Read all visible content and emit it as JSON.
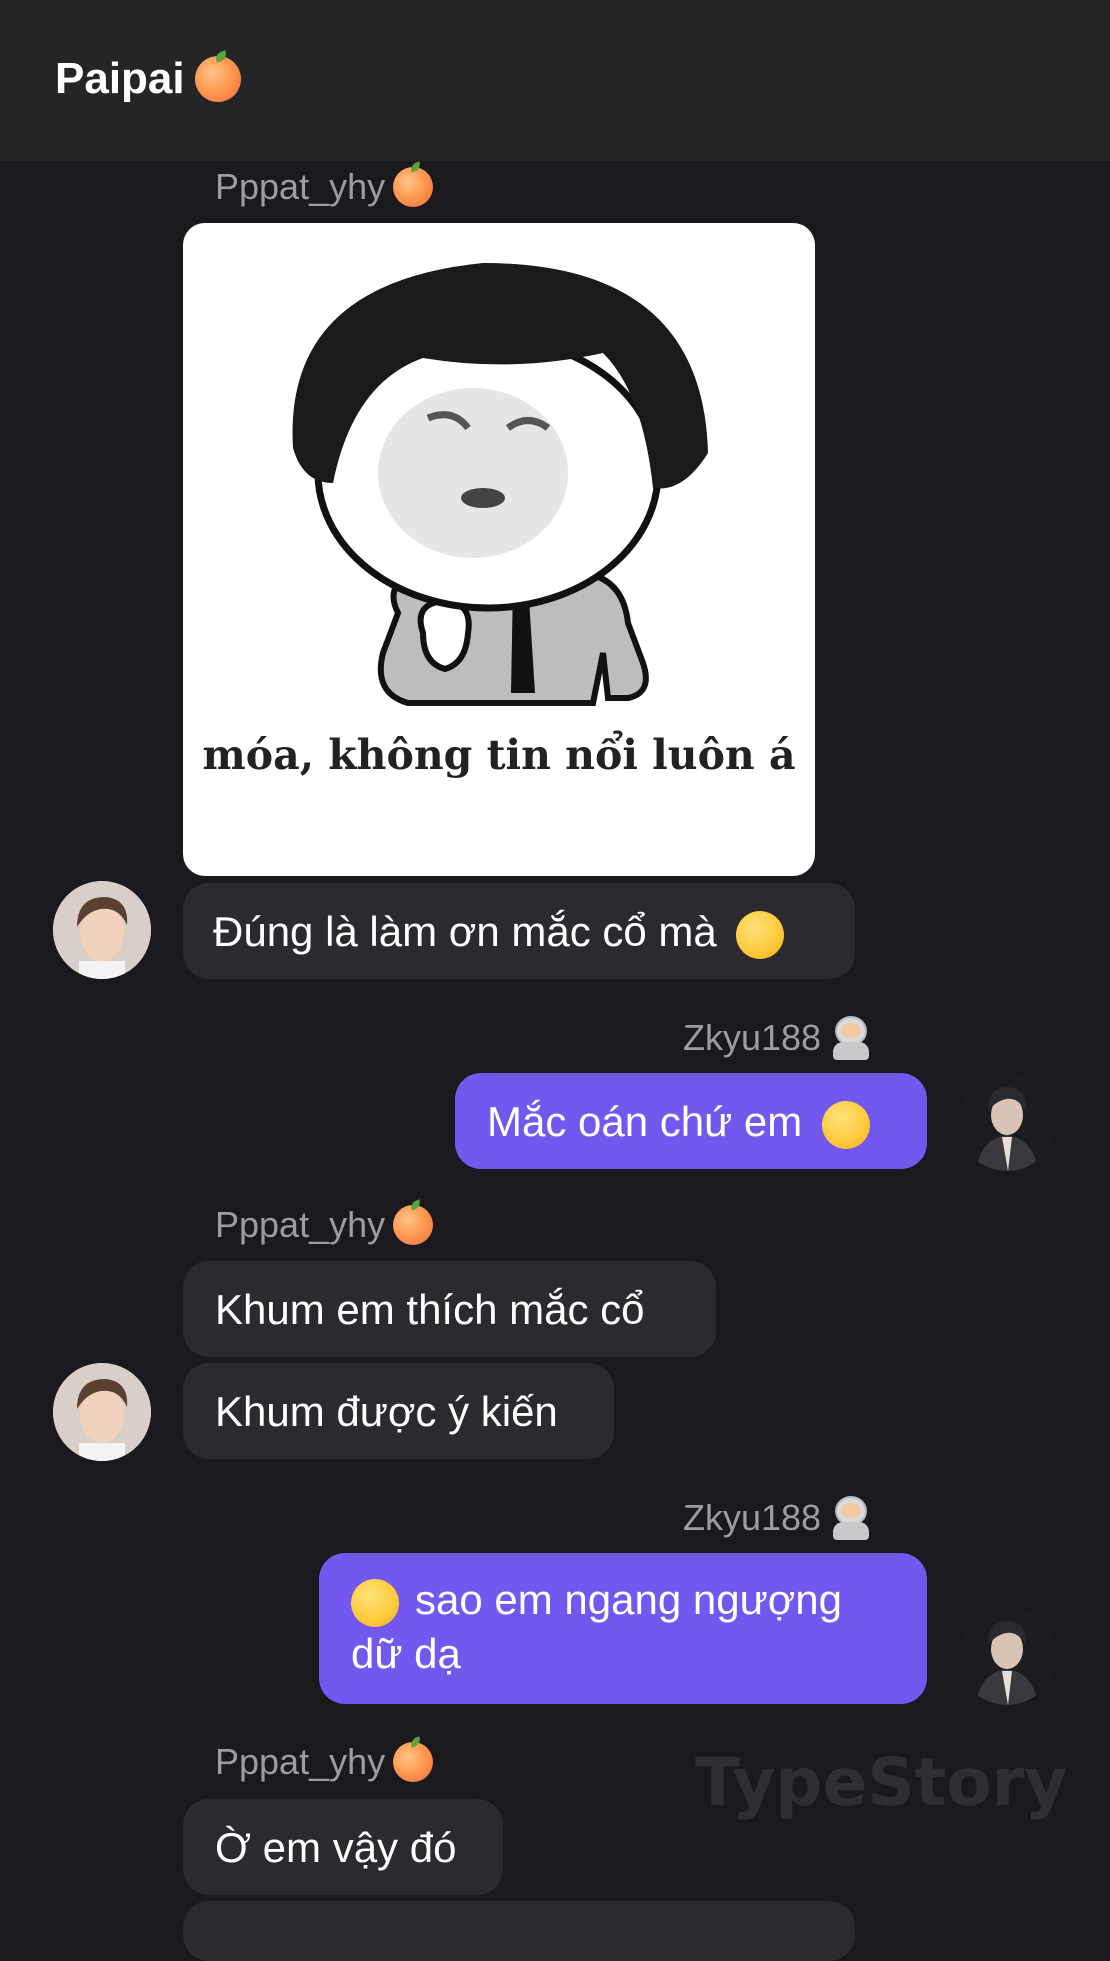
{
  "header": {
    "title": "Paipai",
    "title_icon": "peach-emoji"
  },
  "messages": [
    {
      "sender": "Pppat_yhy",
      "sender_icon": "peach-emoji",
      "type": "sticker",
      "caption": "móa, không tin nổi luôn á"
    },
    {
      "type": "text",
      "direction": "incoming",
      "text": "Đúng là làm ơn mắc cổ mà",
      "emoji": "weary-face-emoji"
    },
    {
      "sender": "Zkyu188",
      "sender_icon": "astronaut-emoji",
      "type": "text",
      "direction": "outgoing",
      "text": "Mắc oán chứ em",
      "emoji": "flushed-face-emoji"
    },
    {
      "sender": "Pppat_yhy",
      "sender_icon": "peach-emoji",
      "type": "text",
      "direction": "incoming",
      "text": "Khum em thích mắc cổ"
    },
    {
      "type": "text",
      "direction": "incoming",
      "text": "Khum được ý kiến"
    },
    {
      "sender": "Zkyu188",
      "sender_icon": "astronaut-emoji",
      "type": "text",
      "direction": "outgoing",
      "text": "sao em ngang ngượng dữ dạ",
      "emoji": "crying-face-emoji"
    },
    {
      "sender": "Pppat_yhy",
      "sender_icon": "peach-emoji",
      "type": "text",
      "direction": "incoming",
      "text": "Ờ em vậy đó"
    }
  ],
  "watermark": "TypeStory",
  "colors": {
    "background": "#1a191d",
    "header": "#252528",
    "incoming_bubble": "#2b2a2f",
    "outgoing_bubble": "#7358f0",
    "sender_name": "#9c9ca2"
  }
}
